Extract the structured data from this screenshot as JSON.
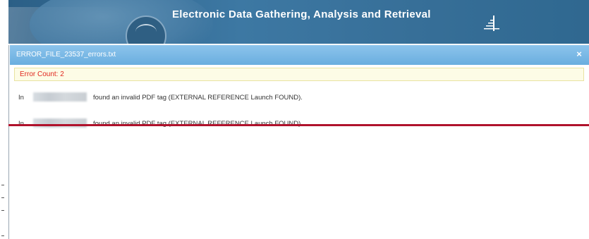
{
  "header": {
    "title": "Electronic Data Gathering, Analysis and Retrieval",
    "seal_icon": "sec-seal-icon",
    "logo_icon": "edgar-stairs-icon",
    "background_color": "#3d78a3"
  },
  "dialog": {
    "title": "ERROR_FILE_23537_errors.txt",
    "close_label": "×",
    "titlebar_color": "#7ab9e6"
  },
  "error_count": {
    "text": "Error Count: 2",
    "color": "#e0261d"
  },
  "messages": [
    {
      "prefix": "In",
      "message": "found an invalid PDF tag (EXTERNAL REFERENCE Launch FOUND)."
    },
    {
      "prefix": "In",
      "message": "found an invalid PDF tag (EXTERNAL REFERENCE Launch FOUND)."
    }
  ],
  "highlight_color": "#b0122c"
}
